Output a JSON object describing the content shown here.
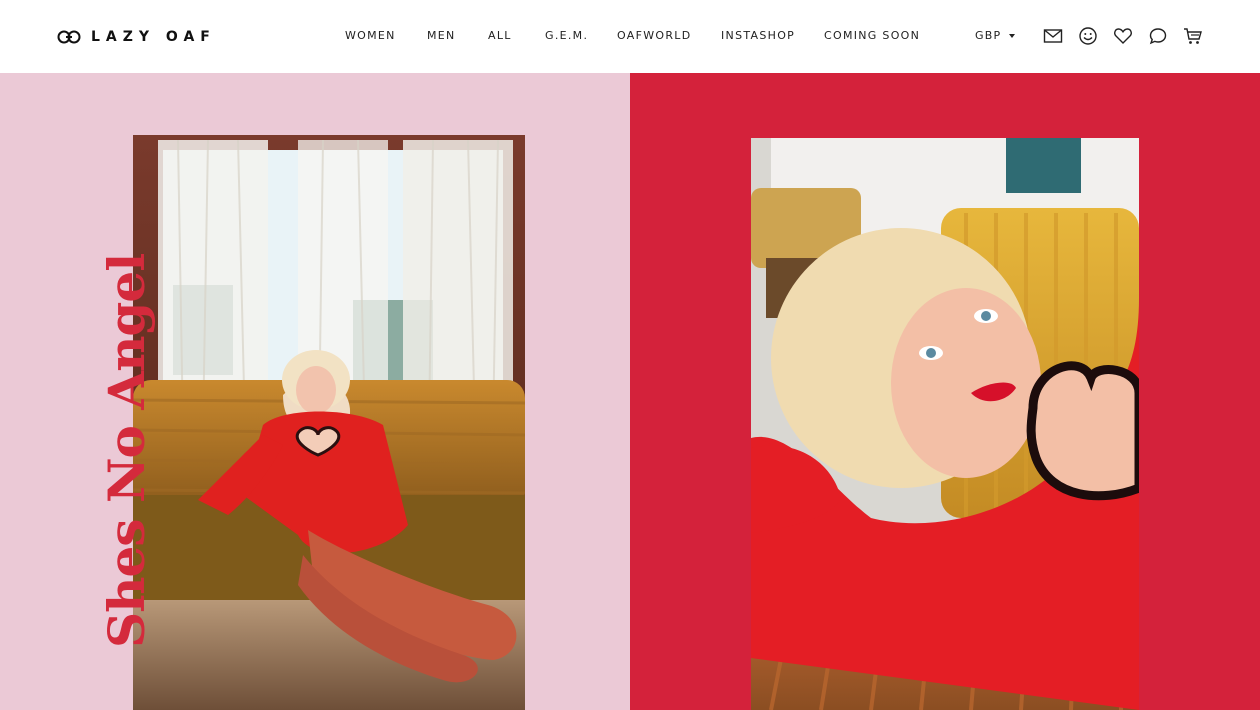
{
  "brand": {
    "name": "LAZY OAF"
  },
  "nav": {
    "items": [
      "WOMEN",
      "MEN",
      "ALL",
      "G.E.M.",
      "OAFWORLD",
      "INSTASHOP",
      "COMING SOON"
    ]
  },
  "currency": {
    "selected": "GBP"
  },
  "icons": {
    "mail": "mail-icon",
    "account": "smiley-icon",
    "wishlist": "heart-icon",
    "chat": "chat-icon",
    "cart": "cart-icon"
  },
  "campaign": {
    "title": "Shes No Angel"
  },
  "colors": {
    "left_panel_bg": "#ebc9d6",
    "right_panel_bg": "#d4223b",
    "title_color": "#d42a3c",
    "header_bg": "#ffffff",
    "text": "#222222"
  }
}
